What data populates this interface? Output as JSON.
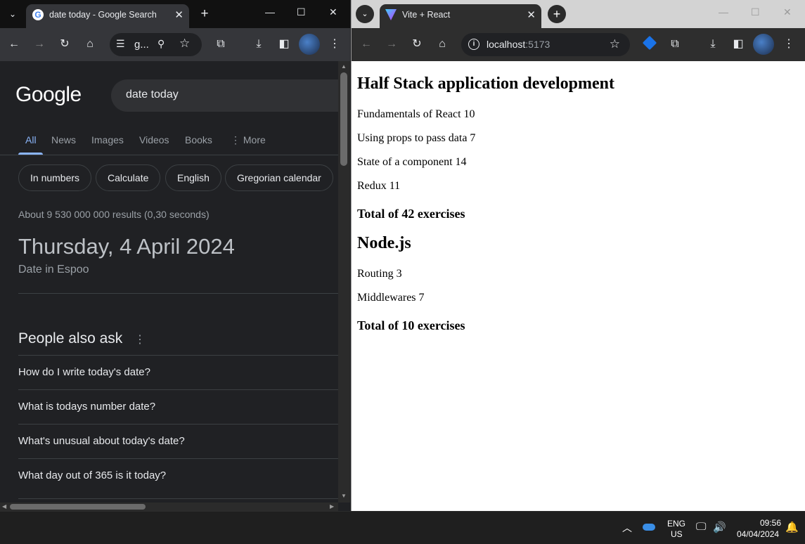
{
  "left_window": {
    "tab_title": "date today - Google Search",
    "tab_favicon": "G",
    "new_tab_symbol": "+",
    "omnibox_text": "g...",
    "google": {
      "logo": "Google",
      "query": "date today",
      "tabs": [
        {
          "label": "All"
        },
        {
          "label": "News"
        },
        {
          "label": "Images"
        },
        {
          "label": "Videos"
        },
        {
          "label": "Books"
        },
        {
          "label": "⋮ More"
        }
      ],
      "chips": [
        {
          "label": "In numbers"
        },
        {
          "label": "Calculate"
        },
        {
          "label": "English"
        },
        {
          "label": "Gregorian calendar"
        }
      ],
      "result_stats": "About 9 530 000 000 results (0,30 seconds)",
      "date_answer": "Thursday, 4 April 2024",
      "date_location": "Date in Espoo",
      "people_also_ask": {
        "heading": "People also ask",
        "questions": [
          {
            "text": "How do I write today's date?"
          },
          {
            "text": "What is todays number date?"
          },
          {
            "text": "What's unusual about today's date?"
          },
          {
            "text": "What day out of 365 is it today?"
          }
        ]
      }
    }
  },
  "right_window": {
    "tab_title": "Vite + React",
    "url_host": "localhost",
    "url_port": ":5173",
    "app": {
      "courses": [
        {
          "name": "Half Stack application development",
          "parts": [
            {
              "text": "Fundamentals of React 10"
            },
            {
              "text": "Using props to pass data 7"
            },
            {
              "text": "State of a component 14"
            },
            {
              "text": "Redux 11"
            }
          ],
          "total": "Total of 42 exercises"
        },
        {
          "name": "Node.js",
          "parts": [
            {
              "text": "Routing 3"
            },
            {
              "text": "Middlewares 7"
            }
          ],
          "total": "Total of 10 exercises"
        }
      ]
    }
  },
  "taskbar": {
    "lang_top": "ENG",
    "lang_bottom": "US",
    "time": "09:56",
    "date": "04/04/2024"
  },
  "icons": {
    "chevron": "⌄",
    "close": "✕",
    "minimize": "—",
    "maximize": "☐",
    "back": "←",
    "forward": "→",
    "reload": "↻",
    "home": "⌂",
    "star": "☆",
    "download": "⤓",
    "menu": "⋮"
  },
  "colors": {
    "google_accent": "#8ab4f8",
    "dark_bg": "#202124",
    "chrome_toolbar": "#35363a"
  }
}
